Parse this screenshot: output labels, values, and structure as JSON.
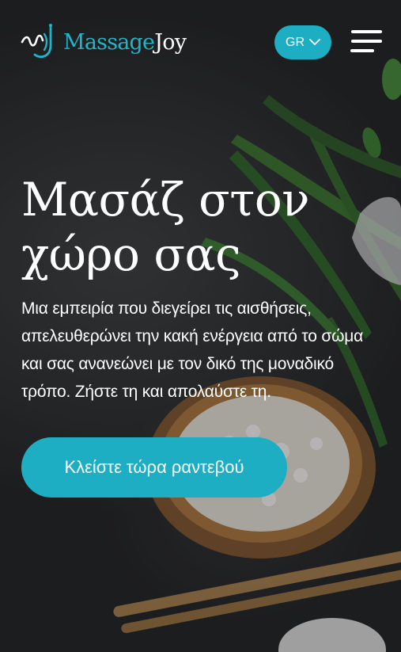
{
  "brand": {
    "name_part1": "Massage",
    "name_part2": "Joy",
    "accent_color": "#1eaec4"
  },
  "header": {
    "language_label": "GR",
    "language_icon": "chevron-down-icon",
    "menu_icon": "hamburger-menu-icon"
  },
  "hero": {
    "title_line1": "Μασάζ στον",
    "title_line2": "χώρο σας",
    "description": "Μια εμπειρία που διεγείρει τις αισθήσεις, απελευθερώνει την κακή ενέργεια από το σώμα και σας ανανεώνει με τον δικό της μοναδικό τρόπο. Ζήστε τη και απολαύστε τη.",
    "cta_label": "Κλείστε τώρα ραντεβού",
    "background_image": "spa-still-life-with-leaves-and-salt-bowl"
  }
}
